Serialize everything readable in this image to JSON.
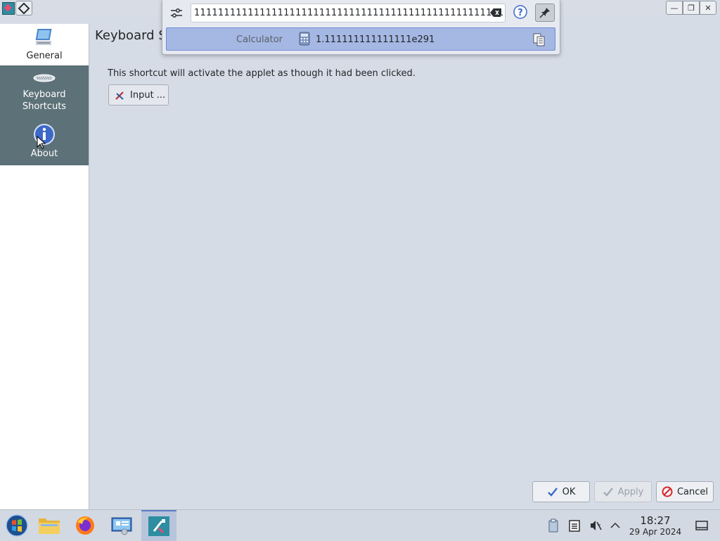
{
  "window": {
    "title_partial": "Keyboard S",
    "controls": [
      "minimize",
      "restore",
      "close"
    ]
  },
  "sidebar": {
    "items": [
      {
        "label": "General",
        "icon": "general-settings-icon",
        "selected": false
      },
      {
        "label": "Keyboard\nShortcuts",
        "line1": "Keyboard",
        "line2": "Shortcuts",
        "icon": "keyboard-icon",
        "selected": true
      },
      {
        "label": "About",
        "icon": "info-icon",
        "selected": true
      }
    ]
  },
  "page": {
    "title": "Keyboard S",
    "description": "This shortcut will activate the applet as though it had been clicked.",
    "input_button": "Input ..."
  },
  "buttons": {
    "ok": "OK",
    "apply": "Apply",
    "cancel": "Cancel"
  },
  "krunner": {
    "query": "111111111111111111111111111111111111111111111111111111111",
    "result_source": "Calculator",
    "result_value": "1.111111111111111e291",
    "pinned": true
  },
  "taskbar": {
    "apps": [
      "start-menu-icon",
      "file-manager-icon",
      "firefox-icon",
      "system-settings-icon",
      "krunner-app-icon"
    ],
    "tray": [
      "clipboard-icon",
      "notes-icon",
      "volume-muted-icon",
      "tray-expand-icon"
    ],
    "time": "18:27",
    "date": "29 Apr 2024"
  },
  "colors": {
    "accent": "#5b7fc7",
    "sidebar_selected": "#5c7178",
    "result_highlight": "#a5b7e3",
    "cancel_red": "#d9252b"
  }
}
